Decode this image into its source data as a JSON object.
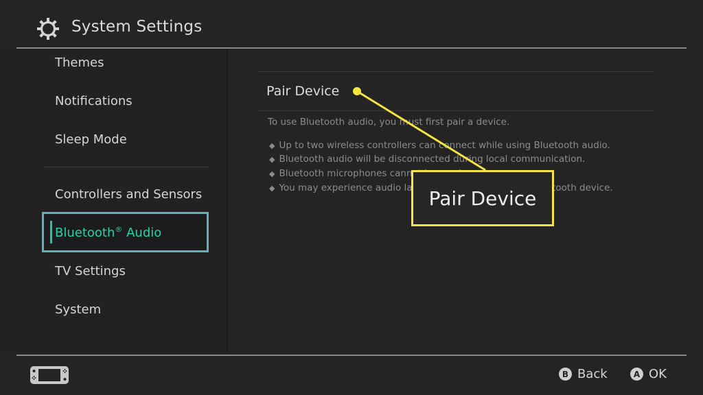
{
  "header": {
    "title": "System Settings",
    "icon": "gear-icon"
  },
  "sidebar": {
    "items": [
      {
        "label": "Themes"
      },
      {
        "label": "Notifications"
      },
      {
        "label": "Sleep Mode"
      },
      {
        "label": "Controllers and Sensors"
      },
      {
        "label": "Bluetooth",
        "suffix": "®",
        "label_rest": " Audio",
        "selected": true
      },
      {
        "label": "TV Settings"
      },
      {
        "label": "System"
      }
    ]
  },
  "main": {
    "option_label": "Pair Device",
    "description": "To use Bluetooth audio, you must first pair a device.",
    "bullets": [
      "Up to two wireless controllers can connect while using Bluetooth audio.",
      "Bluetooth audio will be disconnected during local communication.",
      "Bluetooth microphones cannot be used.",
      "You may experience audio latency depending on your Bluetooth device."
    ]
  },
  "callout": {
    "text": "Pair Device",
    "color": "#f4e542"
  },
  "footer": {
    "back": {
      "key": "B",
      "label": "Back"
    },
    "ok": {
      "key": "A",
      "label": "OK"
    }
  },
  "colors": {
    "accent": "#24d4a6",
    "selection_border": "#5fb3b8",
    "background": "#242424"
  }
}
